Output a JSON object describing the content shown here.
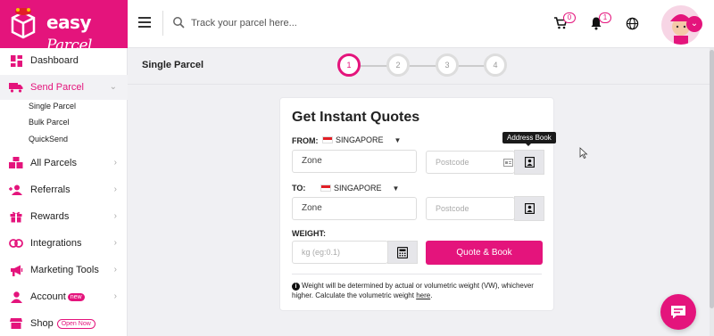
{
  "brand": {
    "name": "easy",
    "script": "Parcel",
    "color": "#e4147c"
  },
  "search": {
    "placeholder": "Track your parcel here..."
  },
  "header_icons": {
    "cart_count": "0",
    "notification_count": "1"
  },
  "sidebar": {
    "items": [
      {
        "label": "Dashboard",
        "icon": "dashboard-icon"
      },
      {
        "label": "Send Parcel",
        "icon": "truck-icon",
        "active": true
      },
      {
        "label": "All Parcels",
        "icon": "parcels-icon"
      },
      {
        "label": "Referrals",
        "icon": "referrals-icon"
      },
      {
        "label": "Rewards",
        "icon": "gift-icon"
      },
      {
        "label": "Integrations",
        "icon": "link-icon"
      },
      {
        "label": "Marketing Tools",
        "icon": "megaphone-icon"
      },
      {
        "label": "Account",
        "icon": "user-icon",
        "badge": "new"
      },
      {
        "label": "Shop",
        "icon": "shop-icon",
        "badge": "Open Now"
      }
    ],
    "sub_items": [
      "Single Parcel",
      "Bulk Parcel",
      "QuickSend"
    ]
  },
  "page": {
    "title": "Single Parcel"
  },
  "stepper": {
    "steps": [
      "1",
      "2",
      "3",
      "4"
    ],
    "active": 1
  },
  "quote": {
    "title": "Get Instant Quotes",
    "from_label": "FROM:",
    "from_country": "SINGAPORE",
    "from_zone": "Zone",
    "from_postcode_placeholder": "Postcode",
    "to_label": "TO:",
    "to_country": "SINGAPORE",
    "to_zone": "Zone",
    "to_postcode_placeholder": "Postcode",
    "weight_label": "WEIGHT:",
    "weight_placeholder": "kg (eg:0.1)",
    "submit_label": "Quote & Book",
    "note_text": "Weight will be determined by actual or volumetric weight (VW), whichever higher. Calculate the volumetric weight",
    "note_link": "here",
    "note_end": "."
  },
  "tooltip": {
    "text": "Address Book"
  }
}
